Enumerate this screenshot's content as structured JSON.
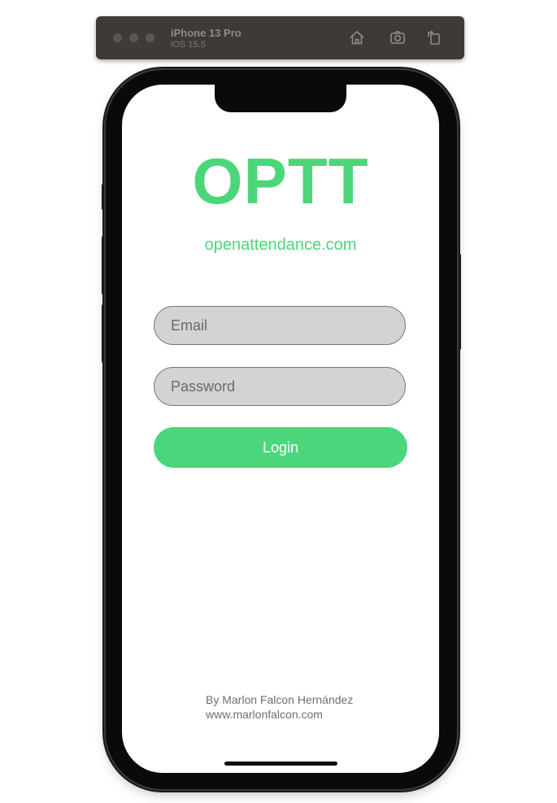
{
  "simulator": {
    "device_name": "iPhone 13 Pro",
    "os_version": "iOS 15.5",
    "icons": [
      "home-icon",
      "screenshot-icon",
      "rotate-icon"
    ]
  },
  "app": {
    "title": "OPTT",
    "website": "openattendance.com",
    "accent_color": "#4cd67b"
  },
  "form": {
    "email_placeholder": "Email",
    "password_placeholder": "Password",
    "login_label": "Login"
  },
  "footer": {
    "author_line": "By Marlon Falcon Hernández",
    "author_url": "www.marlonfalcon.com"
  }
}
